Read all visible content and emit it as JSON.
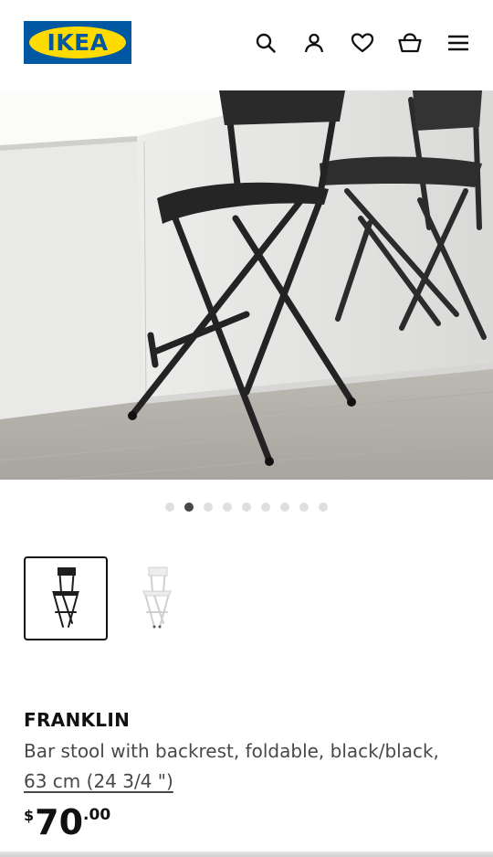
{
  "header": {
    "logo_text": "IKEA",
    "icons": [
      "search-icon",
      "account-icon",
      "heart-icon",
      "cart-icon",
      "menu-icon"
    ]
  },
  "gallery": {
    "slide_count": 9,
    "active_slide": 2
  },
  "thumbnails": [
    {
      "variant": "black",
      "selected": true
    },
    {
      "variant": "white",
      "selected": false
    }
  ],
  "product": {
    "name": "FRANKLIN",
    "description": "Bar stool with backrest, foldable, black/black,",
    "size": "63 cm (24 3/4 \")",
    "price": {
      "currency": "$",
      "integer": "70",
      "decimal": ".00"
    }
  },
  "colors": {
    "brand_blue": "#0058a3",
    "brand_yellow": "#ffdb00",
    "text_primary": "#111111",
    "text_secondary": "#484848"
  }
}
